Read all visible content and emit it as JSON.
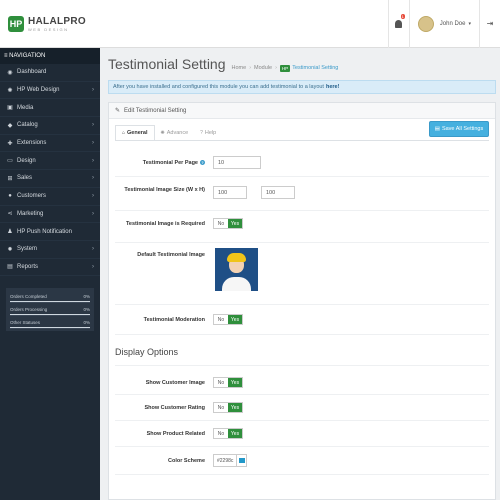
{
  "header": {
    "logo_mark": "HP",
    "logo_name": "HALALPRO",
    "logo_sub": "WEB DESIGN",
    "notification_count": "1",
    "user_name": "John Doe",
    "caret": "▾",
    "logout_icon": "⇥"
  },
  "sidebar": {
    "heading": "≡ NAVIGATION",
    "items": [
      {
        "icon": "dashboard-icon",
        "glyph": "◉",
        "label": "Dashboard",
        "arrow": ""
      },
      {
        "icon": "cogs-icon",
        "glyph": "✺",
        "label": "HP Web Design",
        "arrow": "›"
      },
      {
        "icon": "image-icon",
        "glyph": "▣",
        "label": "Media",
        "arrow": ""
      },
      {
        "icon": "tag-icon",
        "glyph": "◆",
        "label": "Catalog",
        "arrow": "›"
      },
      {
        "icon": "puzzle-icon",
        "glyph": "✚",
        "label": "Extensions",
        "arrow": "›"
      },
      {
        "icon": "desktop-icon",
        "glyph": "▭",
        "label": "Design",
        "arrow": "›"
      },
      {
        "icon": "cart-icon",
        "glyph": "⊞",
        "label": "Sales",
        "arrow": "›"
      },
      {
        "icon": "user-icon",
        "glyph": "●",
        "label": "Customers",
        "arrow": "›"
      },
      {
        "icon": "share-icon",
        "glyph": "⋖",
        "label": "Marketing",
        "arrow": "›"
      },
      {
        "icon": "push-icon",
        "glyph": "♟",
        "label": "HP Push Notification",
        "arrow": ""
      },
      {
        "icon": "cog-icon",
        "glyph": "✹",
        "label": "System",
        "arrow": "›"
      },
      {
        "icon": "bar-chart-icon",
        "glyph": "▤",
        "label": "Reports",
        "arrow": "›"
      }
    ],
    "stats": [
      {
        "label": "Orders Completed",
        "value": "0%"
      },
      {
        "label": "Orders Processing",
        "value": "0%"
      },
      {
        "label": "Other Statuses",
        "value": "0%"
      }
    ]
  },
  "page": {
    "title": "Testimonial Setting",
    "breadcrumb": {
      "home": "Home",
      "module": "Module",
      "hp_tag": "HP",
      "current": "Testimonial Setting",
      "sep": "›"
    },
    "info_text": "After you have installed and configured this module you can add testimonial to a layout",
    "info_link": "here!"
  },
  "panel": {
    "heading": "Edit Testimonial Setting",
    "tabs": [
      {
        "glyph": "⌂",
        "label": "General"
      },
      {
        "glyph": "✺",
        "label": "Advance"
      },
      {
        "glyph": "?",
        "label": "Help"
      }
    ],
    "save_label": "Save All Settings",
    "fields": {
      "per_page_label": "Testimonial Per Page",
      "per_page_value": "10",
      "image_size_label": "Testimonial Image Size (W x H)",
      "image_width": "100",
      "image_height": "100",
      "required_label": "Testimonial Image is Required",
      "default_image_label": "Default Testimonial Image",
      "moderation_label": "Testimonial Moderation",
      "display_title": "Display Options",
      "show_image_label": "Show Customer Image",
      "show_rating_label": "Show Customer Rating",
      "show_product_label": "Show Product Related",
      "color_label": "Color Scheme",
      "color_value": "#2298c",
      "no": "No",
      "yes": "Yes"
    }
  },
  "colors": {
    "accent_green": "#2f8f3c",
    "accent_blue": "#45b0df",
    "color_scheme_swatch": "#2298c9",
    "sidebar_bg": "#1f2a36"
  }
}
